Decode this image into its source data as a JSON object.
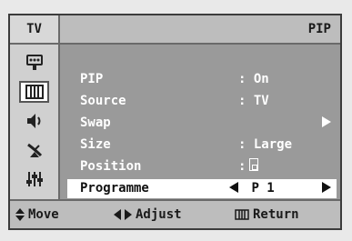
{
  "header": {
    "left_label": "TV",
    "title": "PIP"
  },
  "sidebar": {
    "icons": [
      "input-icon",
      "picture-icon",
      "sound-icon",
      "channel-icon",
      "setup-icon"
    ],
    "active": "picture-icon"
  },
  "menu": {
    "rows": [
      {
        "label": "PIP",
        "value": ": On"
      },
      {
        "label": "Source",
        "value": ": TV"
      },
      {
        "label": "Swap",
        "value": ""
      },
      {
        "label": "Size",
        "value": ": Large"
      },
      {
        "label": "Position",
        "value": ":"
      },
      {
        "label": "Programme",
        "value": "P 1",
        "selected": true
      }
    ]
  },
  "footer": {
    "move": "Move",
    "adjust": "Adjust",
    "return": "Return"
  },
  "colors": {
    "frame_bg": "#9a9a9a",
    "header_bg": "#bdbdbd",
    "selected_bg": "#ffffff",
    "text_light": "#ffffff"
  }
}
